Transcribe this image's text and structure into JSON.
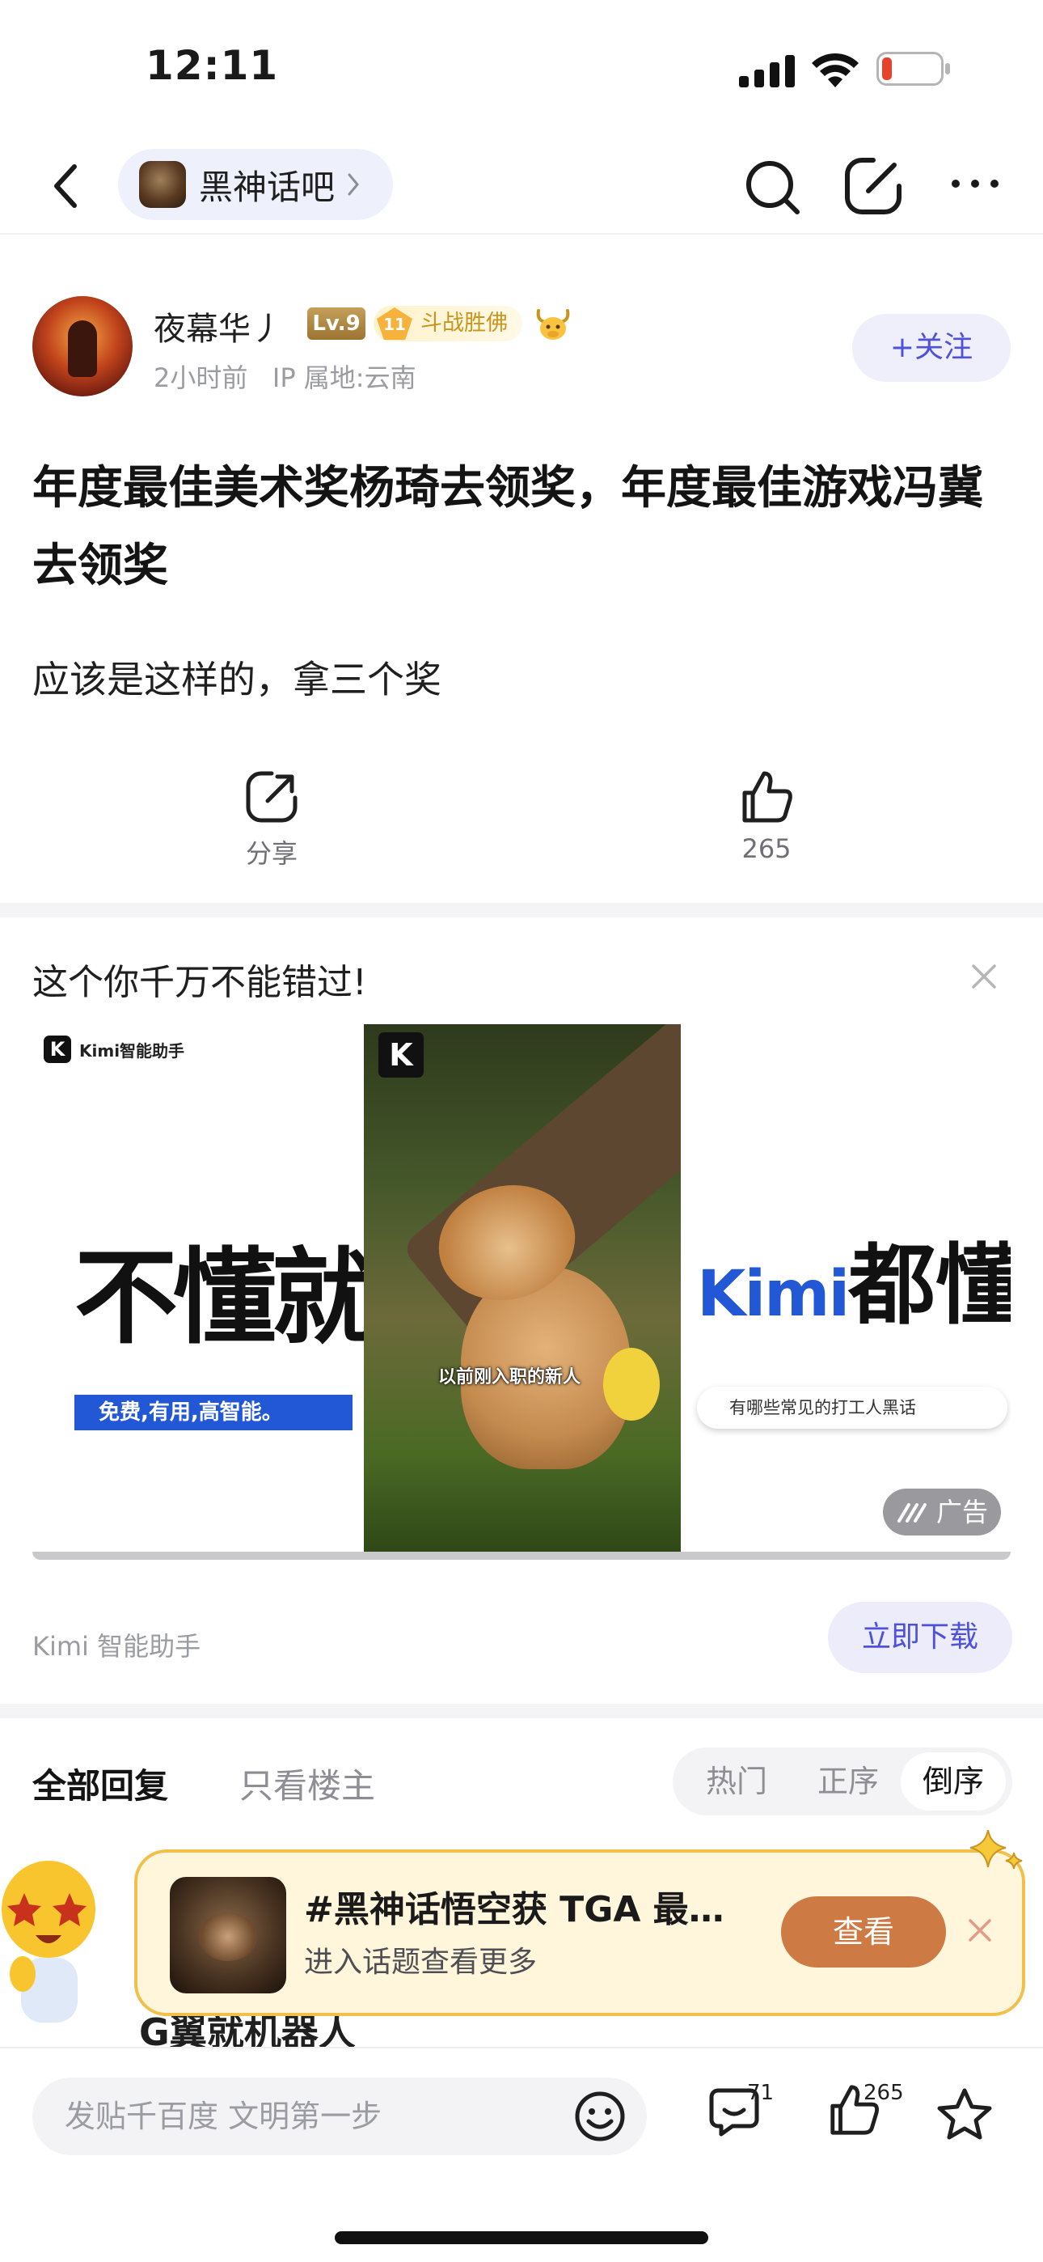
{
  "status": {
    "time": "12:11"
  },
  "nav": {
    "forum_name": "黑神话吧"
  },
  "author": {
    "name": "夜幕华丿",
    "level": "Lv.9",
    "fan_level": "11",
    "fan_title": "斗战胜佛",
    "time_ago": "2小时前",
    "ip_location": "IP 属地:云南",
    "follow_label": "+关注"
  },
  "post": {
    "title": "年度最佳美术奖杨琦去领奖，年度最佳游戏冯冀去领奖",
    "body": "应该是这样的，拿三个奖",
    "share_label": "分享",
    "like_count": "265"
  },
  "ad": {
    "heading": "这个你千万不能错过!",
    "logo_text": "Kimi智能助手",
    "video_logo": "K",
    "slogan": "不懂就问",
    "tagline": "免费,有用,高智能。",
    "video_caption": "以前刚入职的新人",
    "right_brand": "Kimi",
    "right_text": "都懂",
    "input_text": "有哪些常见的打工人黑话",
    "ad_badge": "广告",
    "advertiser": "Kimi 智能助手",
    "cta": "立即下载"
  },
  "reply_tabs": {
    "all": "全部回复",
    "op_only": "只看楼主",
    "sort_hot": "热门",
    "sort_asc": "正序",
    "sort_desc": "倒序"
  },
  "comment_peek": {
    "text": "G翼就机器人"
  },
  "topic": {
    "title": "#黑神话悟空获 TGA 最…",
    "subtitle": "进入话题查看更多",
    "view_label": "查看"
  },
  "bottom": {
    "input_placeholder": "发贴千百度 文明第一步",
    "comment_count": "71",
    "like_count": "265"
  },
  "colors": {
    "accent": "#4e52d8",
    "topic_button": "#ce7a44",
    "kimi_blue": "#2257d6"
  }
}
